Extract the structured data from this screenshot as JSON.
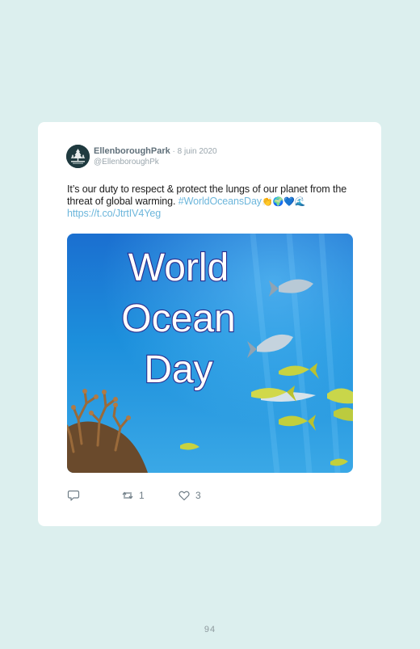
{
  "tweet": {
    "author_name": "EllenboroughPark",
    "date": " · 8 juin 2020",
    "handle": "@EllenboroughPk",
    "text_plain": "It’s our duty to respect & protect the lungs of our planet from the threat of global warming. ",
    "hashtag": "#WorldOceansDay",
    "emojis": "👏🌍💙🌊",
    "link": "https://t.co/JtrtIV4Yeg",
    "image_caption": [
      "World",
      "Ocean",
      "Day"
    ],
    "actions": {
      "reply_count": "",
      "retweet_count": "1",
      "like_count": "3"
    }
  },
  "page": {
    "number": "94"
  },
  "colors": {
    "background": "#dcefee",
    "card": "#ffffff",
    "link": "#6cb6db",
    "caption_fill": "#ffffff",
    "caption_stroke": "#2b2c8c"
  },
  "icons": [
    "avatar-crest-icon",
    "reply-icon",
    "retweet-icon",
    "heart-icon"
  ]
}
